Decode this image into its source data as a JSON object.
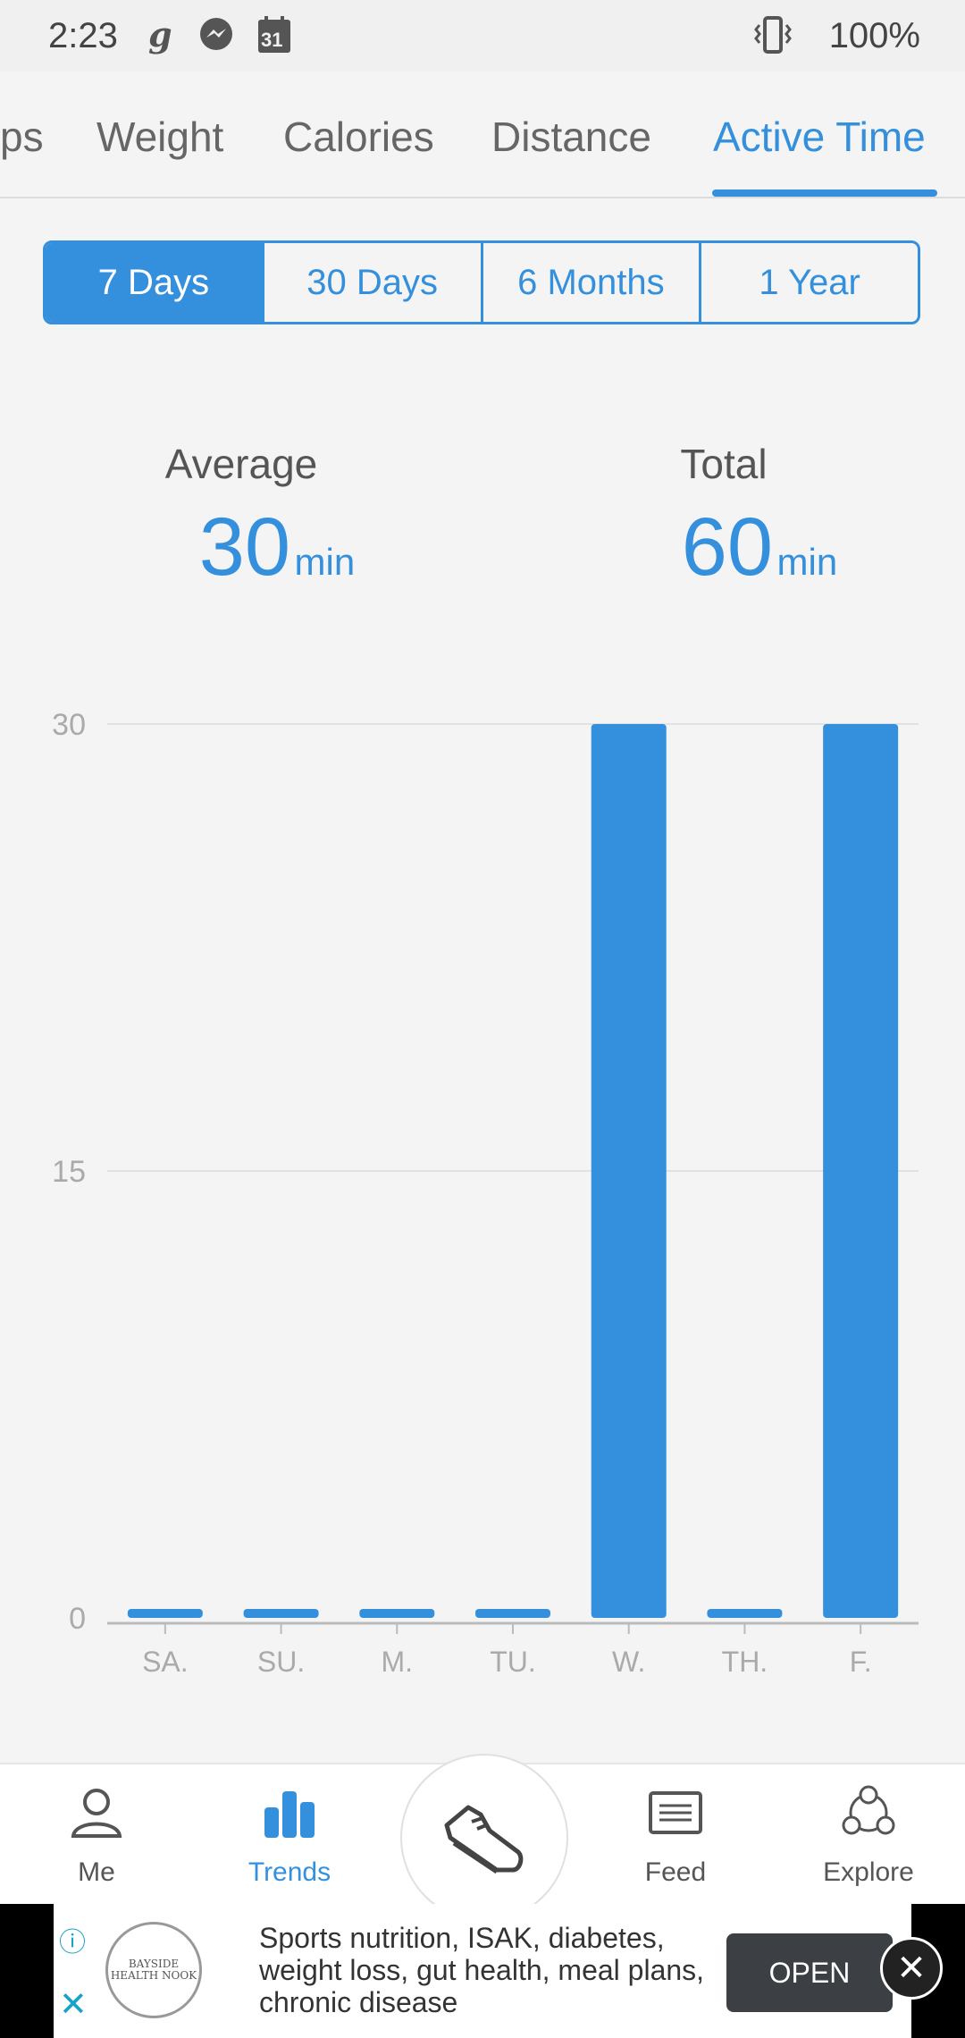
{
  "status": {
    "time": "2:23",
    "battery": "100%",
    "calendar_day": "31",
    "icons": [
      "goodreads-icon",
      "messenger-icon",
      "calendar-icon",
      "vibrate-icon"
    ]
  },
  "tabs": [
    {
      "label": "ps",
      "active": false
    },
    {
      "label": "Weight",
      "active": false
    },
    {
      "label": "Calories",
      "active": false
    },
    {
      "label": "Distance",
      "active": false
    },
    {
      "label": "Active Time",
      "active": true
    }
  ],
  "ranges": [
    {
      "label": "7 Days",
      "active": true
    },
    {
      "label": "30 Days",
      "active": false
    },
    {
      "label": "6 Months",
      "active": false
    },
    {
      "label": "1 Year",
      "active": false
    }
  ],
  "summary": {
    "average_label": "Average",
    "average_value": "30",
    "average_unit": "min",
    "total_label": "Total",
    "total_value": "60",
    "total_unit": "min"
  },
  "chart_data": {
    "type": "bar",
    "categories": [
      "SA.",
      "SU.",
      "M.",
      "TU.",
      "W.",
      "TH.",
      "F."
    ],
    "values": [
      0,
      0,
      0,
      0,
      30,
      0,
      30
    ],
    "yticks": [
      0,
      15,
      30
    ],
    "ylim": [
      0,
      30
    ],
    "grid": true,
    "color": "#3490dc"
  },
  "nav": [
    {
      "label": "Me",
      "icon": "person-icon",
      "active": false
    },
    {
      "label": "Trends",
      "icon": "bar-chart-icon",
      "active": true
    },
    {
      "label": "",
      "icon": "shoe-icon",
      "active": false
    },
    {
      "label": "Feed",
      "icon": "feed-icon",
      "active": false
    },
    {
      "label": "Explore",
      "icon": "explore-icon",
      "active": false
    }
  ],
  "ad": {
    "logo_text": "BAYSIDE HEALTH NOOK",
    "text": "Sports nutrition, ISAK, diabetes, weight loss, gut health, meal plans, chronic disease",
    "button": "OPEN"
  },
  "colors": {
    "accent": "#3490dc",
    "background": "#f4f4f4"
  }
}
